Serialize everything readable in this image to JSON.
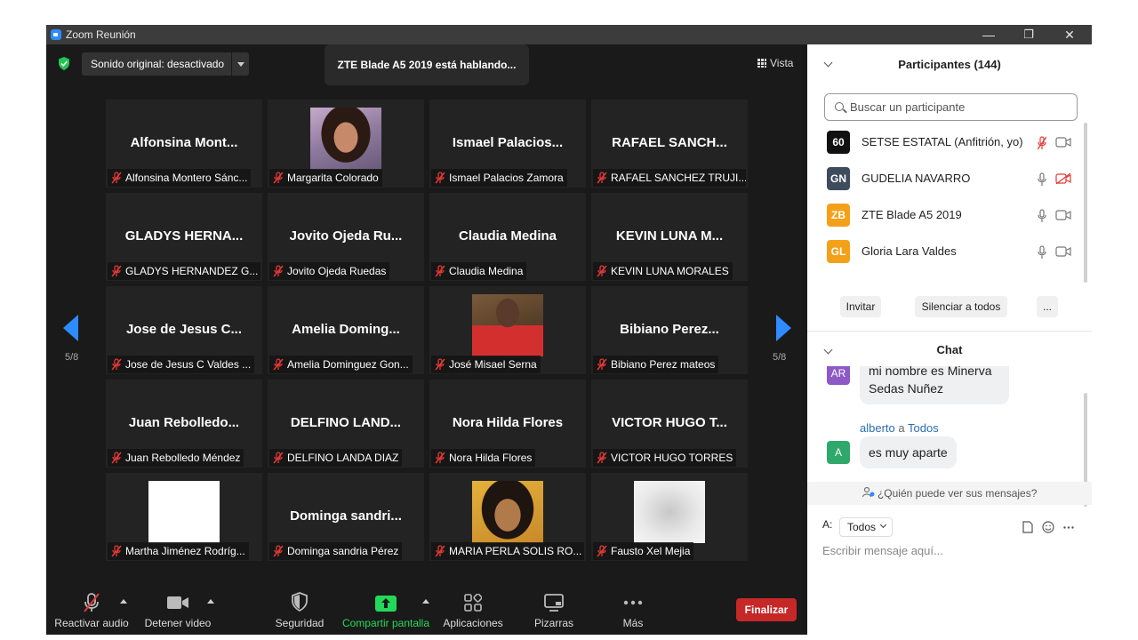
{
  "window": {
    "title": "Zoom Reunión",
    "minimize": "—",
    "restore": "❐",
    "close": "✕"
  },
  "top": {
    "sound": "Sonido original: desactivado",
    "speaking": "ZTE Blade A5 2019 está hablando...",
    "view": "Vista"
  },
  "page": {
    "left": "5/8",
    "right": "5/8"
  },
  "tiles": [
    {
      "big": "Alfonsina  Mont...",
      "tag": "Alfonsina Montero Sánc..."
    },
    {
      "big": "",
      "tag": "Margarita Colorado",
      "photo": "portrait-woman"
    },
    {
      "big": "Ismael  Palacios...",
      "tag": "Ismael Palacios Zamora"
    },
    {
      "big": "RAFAEL  SANCH...",
      "tag": "RAFAEL SANCHEZ TRUJI..."
    },
    {
      "big": "GLADYS  HERNA...",
      "tag": "GLADYS HERNANDEZ G..."
    },
    {
      "big": "Jovito  Ojeda  Ru...",
      "tag": "Jovito Ojeda Ruedas"
    },
    {
      "big": "Claudia Medina",
      "tag": "Claudia Medina"
    },
    {
      "big": "KEVIN  LUNA  M...",
      "tag": "KEVIN LUNA MORALES"
    },
    {
      "big": "Jose de Jesus C...",
      "tag": "Jose de Jesus C Valdes ..."
    },
    {
      "big": "Amelia  Doming...",
      "tag": "Amelia Dominguez Gon..."
    },
    {
      "big": "",
      "tag": "José Misael Serna",
      "photo": "basketball-player"
    },
    {
      "big": "Bibiano  Perez...",
      "tag": "Bibiano Perez  mateos"
    },
    {
      "big": "Juan  Rebolledo...",
      "tag": "Juan Rebolledo Méndez"
    },
    {
      "big": "DELFINO  LAND...",
      "tag": "DELFINO LANDA DIAZ"
    },
    {
      "big": "Nora Hilda Flores",
      "tag": "Nora Hilda Flores"
    },
    {
      "big": "VICTOR  HUGO  T...",
      "tag": "VICTOR HUGO TORRES"
    },
    {
      "big": "",
      "tag": "Martha Jiménez Rodríg...",
      "photo": "white-video"
    },
    {
      "big": "Dominga  sandri...",
      "tag": "Dominga sandria Pérez"
    },
    {
      "big": "",
      "tag": "MARIA PERLA SOLIS RO...",
      "photo": "portrait-woman-2"
    },
    {
      "big": "",
      "tag": "Fausto Xel Mejia",
      "photo": "blurred-video"
    }
  ],
  "toolbar": {
    "audio": "Reactivar audio",
    "video": "Detener video",
    "security": "Seguridad",
    "share": "Compartir pantalla",
    "apps": "Aplicaciones",
    "whiteboard": "Pizarras",
    "more": "Más",
    "end": "Finalizar"
  },
  "participants": {
    "title": "Participantes (144)",
    "search_placeholder": "Buscar un participante",
    "list": [
      {
        "initials": "60",
        "name": "SETSE ESTATAL (Anfitrión, yo)",
        "color": "#111111",
        "mic": "muted",
        "cam": "on"
      },
      {
        "initials": "GN",
        "name": "GUDELIA NAVARRO",
        "color": "#3d4d5e",
        "mic": "on",
        "cam": "off"
      },
      {
        "initials": "ZB",
        "name": "ZTE Blade A5 2019",
        "color": "#f4a11a",
        "mic": "on",
        "cam": "on"
      },
      {
        "initials": "GL",
        "name": "Gloria  Lara Valdes",
        "color": "#f4a11a",
        "mic": "on",
        "cam": "on"
      }
    ],
    "invite": "Invitar",
    "mute_all": "Silenciar a todos",
    "more": "..."
  },
  "chat": {
    "title": "Chat",
    "msg1_avatar": "AR",
    "msg1_line1": "mi nombre es Minerva",
    "msg1_line2": "Sedas Nuñez",
    "msg2_sender": "alberto",
    "msg2_to_word": "a",
    "msg2_to": "Todos",
    "msg2_avatar": "A",
    "msg2_text": "es muy aparte",
    "privacy": "¿Quién puede ver sus mensajes?",
    "to_label": "A:",
    "to_value": "Todos",
    "input_placeholder": "Escribir mensaje aquí..."
  },
  "colors": {
    "accent": "#2d8cff",
    "end": "#c62828",
    "share": "#23d959",
    "muted": "#e53935"
  }
}
